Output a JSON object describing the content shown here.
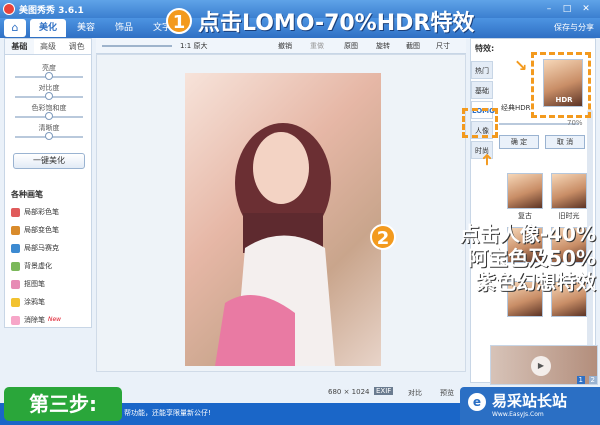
{
  "app": {
    "title": "美图秀秀 3.6.1",
    "share": "保存与分享"
  },
  "nav": {
    "tabs": [
      "美化",
      "美容",
      "饰品",
      "文字"
    ],
    "active": "美化",
    "home_icon": "home-icon"
  },
  "steps": {
    "step1_number": "1",
    "step1_text": "点击LOMO-70%HDR特效",
    "step2_number": "2",
    "step2_lines": [
      "点击人像-40%",
      "阿宝色及50%",
      "紫色幻想特效"
    ],
    "step3_badge": "第三步:"
  },
  "left": {
    "tabs": [
      "基础",
      "高级",
      "调色"
    ],
    "sliders": [
      {
        "label": "亮度",
        "value": 0.5
      },
      {
        "label": "对比度",
        "value": 0.5
      },
      {
        "label": "色彩饱和度",
        "value": 0.5
      },
      {
        "label": "清晰度",
        "value": 0.5
      }
    ],
    "onekey": "一键美化",
    "brushes_title": "各种画笔",
    "brushes": [
      {
        "label": "局部彩色笔",
        "color": "#e05b5b"
      },
      {
        "label": "局部变色笔",
        "color": "#d98b2b"
      },
      {
        "label": "局部马赛克",
        "color": "#3c8ad1"
      },
      {
        "label": "背景虚化",
        "color": "#7bb85a"
      },
      {
        "label": "抠图笔",
        "color": "#e78bb5"
      },
      {
        "label": "涂鸦笔",
        "color": "#f2c230"
      },
      {
        "label": "消除笔",
        "color": "#f7a6c8"
      }
    ],
    "new_tag": "New"
  },
  "toolbar": {
    "zoom": "1:1 原大",
    "undo": "撤销",
    "redo": "重做",
    "original": "原图",
    "rotate": "旋转",
    "crop": "截图",
    "size": "尺寸"
  },
  "canvas": {
    "dimensions": "680 × 1024",
    "exif": "EXIF",
    "compare": "对比",
    "preview": "预览"
  },
  "right": {
    "title": "特效:",
    "tabs": [
      "热门",
      "基础",
      "LOMO",
      "人像",
      "时尚"
    ],
    "top_label": "经典HDR",
    "hdr_label": "HDR",
    "percent": "70%",
    "confirm": "确 定",
    "cancel": "取 消",
    "thumbs": [
      "",
      "",
      " ",
      "",
      "",
      " "
    ],
    "thumb_labels": [
      "复古",
      "旧时光",
      "",
      "",
      "",
      ""
    ],
    "pager": [
      "1",
      "2"
    ]
  },
  "status": {
    "text": "帮功能，还能享限量新公仔!"
  },
  "watermark": {
    "site": "易采站长站",
    "url": "Www.EasyJs.Com"
  }
}
